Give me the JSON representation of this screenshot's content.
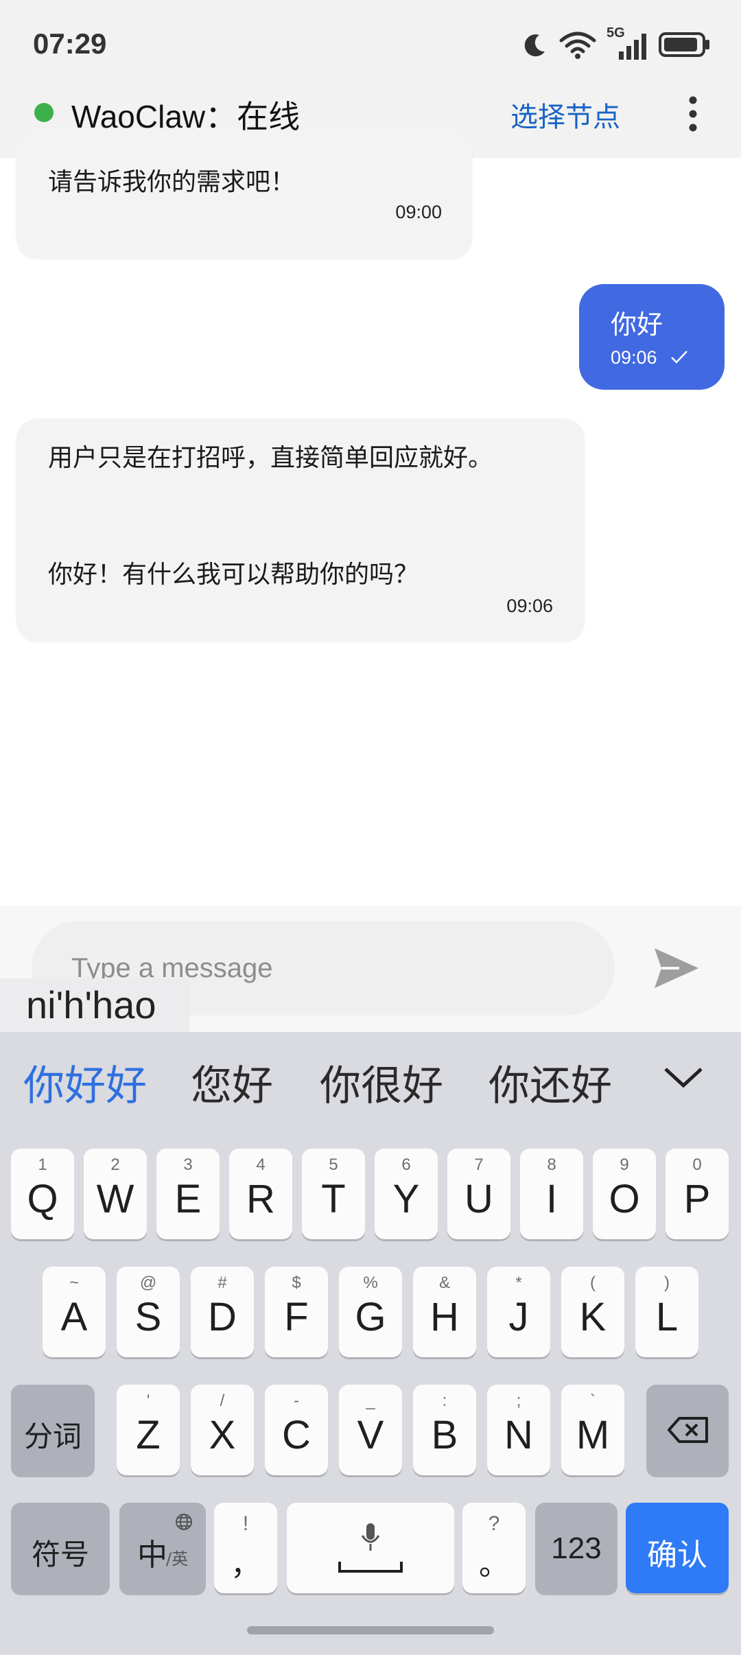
{
  "status_bar": {
    "time": "07:29",
    "icons": [
      "moon-icon",
      "wifi-icon",
      "5g-signal-icon",
      "battery-icon"
    ],
    "network_label": "5G"
  },
  "header": {
    "title": "WaoClaw：在线",
    "online_color": "#3cb04a",
    "select_node_label": "选择节点",
    "more_icon": "more-vertical-icon",
    "accent_color": "#1864c4"
  },
  "messages": [
    {
      "from": "bot",
      "lines": [
        "请告诉我你的需求吧！"
      ],
      "time": "09:00"
    },
    {
      "from": "user",
      "lines": [
        "你好"
      ],
      "time": "09:06",
      "status_icon": "check-icon"
    },
    {
      "from": "bot",
      "lines": [
        "用户只是在打招呼，直接简单回应就好。",
        "你好！有什么我可以帮助你的吗？"
      ],
      "time": "09:06"
    }
  ],
  "composer": {
    "placeholder": "Type a message",
    "send_icon": "send-icon"
  },
  "ime": {
    "pinyin": "ni'h'hao",
    "candidates": [
      "你好好",
      "您好",
      "你很好",
      "你还好"
    ],
    "expand_icon": "chevron-down-icon",
    "row1": [
      {
        "main": "Q",
        "sub": "1"
      },
      {
        "main": "W",
        "sub": "2"
      },
      {
        "main": "E",
        "sub": "3"
      },
      {
        "main": "R",
        "sub": "4"
      },
      {
        "main": "T",
        "sub": "5"
      },
      {
        "main": "Y",
        "sub": "6"
      },
      {
        "main": "U",
        "sub": "7"
      },
      {
        "main": "I",
        "sub": "8"
      },
      {
        "main": "O",
        "sub": "9"
      },
      {
        "main": "P",
        "sub": "0"
      }
    ],
    "row2": [
      {
        "main": "A",
        "sub": "~"
      },
      {
        "main": "S",
        "sub": "@"
      },
      {
        "main": "D",
        "sub": "#"
      },
      {
        "main": "F",
        "sub": "$"
      },
      {
        "main": "G",
        "sub": "%"
      },
      {
        "main": "H",
        "sub": "&"
      },
      {
        "main": "J",
        "sub": "*"
      },
      {
        "main": "K",
        "sub": "("
      },
      {
        "main": "L",
        "sub": ")"
      }
    ],
    "row3": [
      {
        "main": "Z",
        "sub": "'"
      },
      {
        "main": "X",
        "sub": "/"
      },
      {
        "main": "C",
        "sub": "-"
      },
      {
        "main": "V",
        "sub": "_"
      },
      {
        "main": "B",
        "sub": ":"
      },
      {
        "main": "N",
        "sub": ";"
      },
      {
        "main": "M",
        "sub": "`"
      }
    ],
    "segment_label": "分词",
    "symbol_label": "符号",
    "lang_main": "中",
    "lang_sub": "/英",
    "comma_main": "，",
    "comma_sub": "!",
    "period_main": "。",
    "period_sub": "?",
    "num_label": "123",
    "confirm_label": "确认",
    "confirm_color": "#2f7af6"
  }
}
